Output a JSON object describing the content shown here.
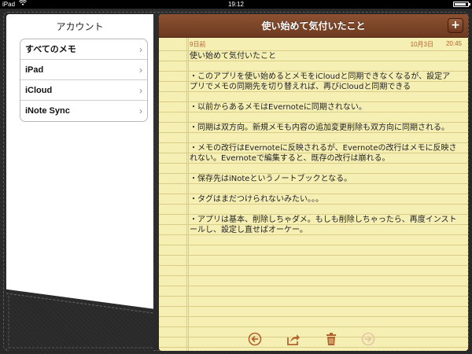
{
  "status_bar": {
    "device": "iPad",
    "time": "19:12",
    "icons": [
      "wifi-icon",
      "battery-icon"
    ],
    "battery_level": 0.85
  },
  "sidebar": {
    "title": "アカウント",
    "items": [
      {
        "label": "すべてのメモ",
        "icon": "chevron-right-icon"
      },
      {
        "label": "iPad",
        "icon": "chevron-right-icon"
      },
      {
        "label": "iCloud",
        "icon": "chevron-right-icon"
      },
      {
        "label": "iNote Sync",
        "icon": "chevron-right-icon"
      }
    ],
    "chevron": "›"
  },
  "note": {
    "title": "使い始めて気付いたこと",
    "add_label": "+",
    "relative_date": "9日前",
    "date": "10月3日",
    "time": "20:45",
    "paragraphs": [
      "使い始めて気付いたこと",
      "・このアプリを使い始めるとメモをiCloudと同期できなくなるが、設定アプリでメモの同期先を切り替えれば、再びiCloudと同期できる",
      "・以前からあるメモはEvernoteに同期されない。",
      "・同期は双方向。新規メモも内容の追加変更削除も双方向に同期される。",
      "・メモの改行はEvernoteに反映されるが、Evernoteの改行はメモに反映されない。Evernoteで編集すると、既存の改行は崩れる。",
      "・保存先はiNoteというノートブックとなる。",
      "・タグはまだつけられないみたい。。。",
      "・アプリは基本、削除しちゃダメ。もしも削除しちゃったら、再度インストールし、設定し直せばオーケー。"
    ]
  },
  "toolbar": {
    "buttons": [
      "back-arrow-icon",
      "share-icon",
      "trash-icon",
      "forward-arrow-icon"
    ]
  },
  "colors": {
    "header_brown": "#7a4327",
    "paper_yellow": "#f6efb4",
    "accent_orange": "#b3632e",
    "leather": "#2b2b2b"
  }
}
